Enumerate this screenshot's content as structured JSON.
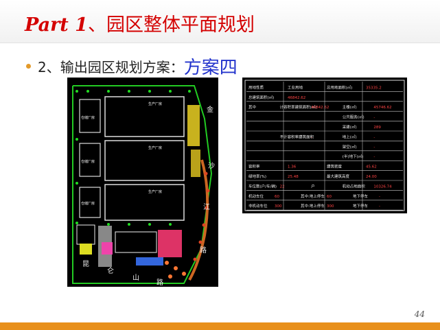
{
  "title": {
    "part": "Part 1",
    "cjk": "、园区整体平面规划"
  },
  "bullet": {
    "prefix": "2、输出园区规划方案：",
    "emphasis": "方案四"
  },
  "plan_labels": {
    "road_right": [
      "金",
      "沙",
      "江",
      "路"
    ],
    "road_bottom": [
      "昆",
      "仑",
      "山",
      "路"
    ],
    "buildings": [
      "生产厂房",
      "仓储厂房",
      "生产厂房",
      "仓储厂房",
      "生产厂房",
      "仓储厂房"
    ]
  },
  "table": {
    "rows": [
      [
        "用地性质",
        "工业用地",
        "总用地面积(㎡)",
        "35335.2"
      ],
      [
        "总建筑面积(㎡)",
        "46842.62",
        "",
        ""
      ],
      [
        "其中",
        "计容积率建筑面积(㎡)",
        "46842.62",
        "主楼(㎡)",
        "45746.62"
      ],
      [
        "",
        "",
        "",
        "公共服务(㎡)",
        "-"
      ],
      [
        "",
        "",
        "",
        "采建(㎡)",
        "289"
      ],
      [
        "",
        "不计容积率建筑面积",
        "-",
        "地上(㎡)",
        "-"
      ],
      [
        "",
        "",
        "",
        "架空(㎡)",
        "-"
      ],
      [
        "",
        "",
        "",
        "(半)地下(㎡)",
        "-"
      ],
      [
        "容积率",
        "1.36",
        "建筑密度",
        "45.62"
      ],
      [
        "绿地率(%)",
        "25.48",
        "最大建筑高度",
        "24.00"
      ],
      [
        "车位数(户/车/辆)",
        "22",
        "户",
        "机动占地面积",
        "10326.74"
      ],
      [
        "机动车位",
        "60",
        "其中:地上停车",
        "60",
        "地下停车",
        "-"
      ],
      [
        "非机动车位",
        "300",
        "其中:地上停车",
        "300",
        "地下停车",
        "-"
      ]
    ]
  },
  "page_number": "44",
  "colors": {
    "title": "#d40000",
    "emphasis": "#2233cc",
    "bullet": "#e39a2a",
    "footer": "#e8901c"
  }
}
